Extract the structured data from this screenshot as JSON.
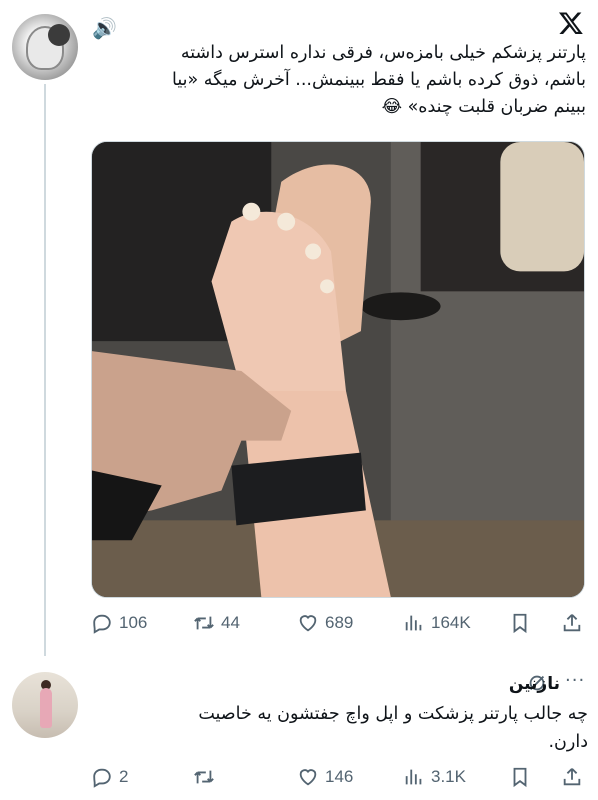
{
  "tweet": {
    "author_icon": "speaker-icon",
    "platform_icon": "x-logo-icon",
    "text_line1": "پارتنر پزشکم خیلی بامزه‌س، فرقی نداره استرس داشته",
    "text_line2": "باشم، ذوق کرده باشم یا فقط ببینمش... آخرش میگه «بیا",
    "text_line3": "ببینم ضربان قلبت چنده» 😂",
    "stats": {
      "replies": "106",
      "reposts": "44",
      "likes": "689",
      "views": "164K"
    }
  },
  "reply": {
    "name": "نازنین",
    "text_line1": "چه جالب پارتنر پزشکت و اپل واچ جفتشون یه خاصیت",
    "text_line2": "دارن.",
    "stats": {
      "replies": "2",
      "reposts": "",
      "likes": "146",
      "views": "3.1K"
    }
  },
  "colors": {
    "text": "#0f1419",
    "muted": "#536471",
    "divider": "#cfd9de"
  }
}
